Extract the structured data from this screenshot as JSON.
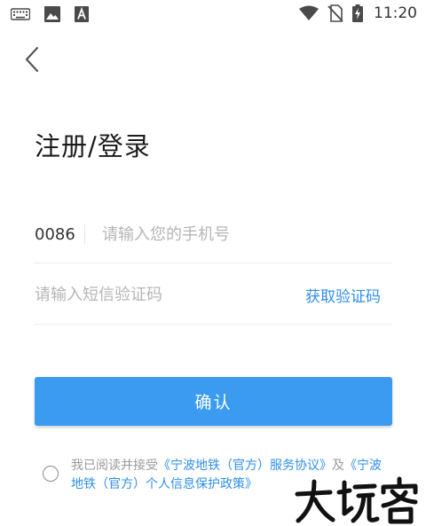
{
  "status_bar": {
    "time": "11:20",
    "left_icons": [
      "keyboard-icon",
      "image-icon",
      "font-icon"
    ],
    "right_icons": [
      "wifi-icon",
      "no-sim-icon",
      "battery-charging-icon"
    ]
  },
  "header": {
    "back_icon": "chevron-left-icon"
  },
  "title": "注册/登录",
  "phone": {
    "country_code": "0086",
    "placeholder": "请输入您的手机号",
    "value": ""
  },
  "verification": {
    "placeholder": "请输入短信验证码",
    "value": "",
    "get_code_label": "获取验证码"
  },
  "confirm_label": "确认",
  "agreement": {
    "checked": false,
    "prefix": "我已阅读并接受",
    "service_link": "《宁波地铁（官方）服务协议》",
    "conjunction": "及",
    "privacy_link": "《宁波地铁（官方）个人信息保护政策》"
  },
  "watermark": {
    "text": "大玩客"
  },
  "colors": {
    "accent": "#3b9bf1",
    "link": "#2f8fe8",
    "placeholder": "#b5b5b5",
    "divider": "#ececec"
  }
}
